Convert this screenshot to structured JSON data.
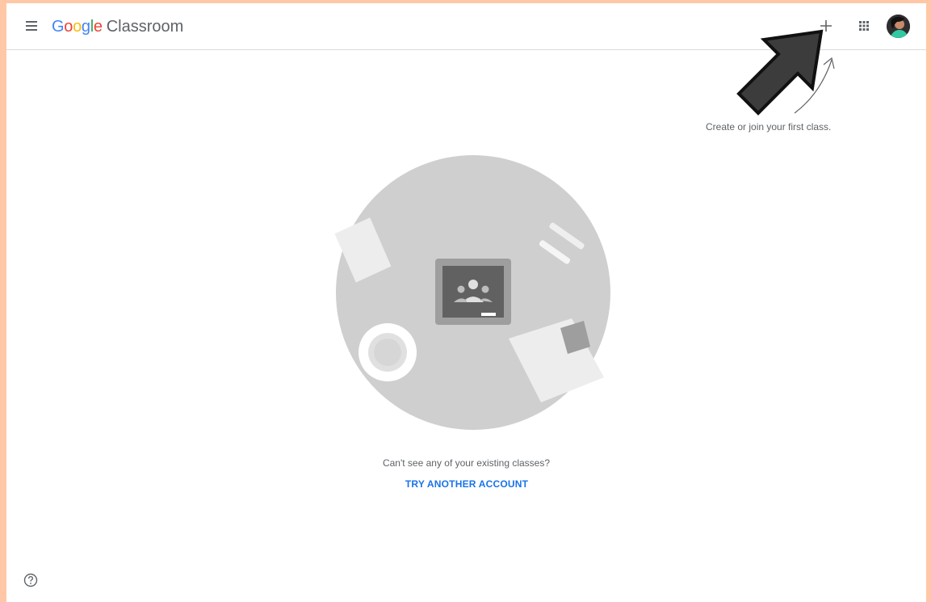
{
  "header": {
    "logo_google": "Google",
    "logo_product": "Classroom",
    "menu_icon": "hamburger-menu-icon",
    "create_icon": "plus-icon",
    "apps_icon": "apps-grid-icon",
    "avatar_icon": "account-avatar"
  },
  "hint": {
    "text": "Create or join your first class."
  },
  "empty_state": {
    "question": "Can't see any of your existing classes?",
    "action": "TRY ANOTHER ACCOUNT"
  },
  "footer": {
    "help_icon": "help-icon"
  },
  "colors": {
    "google_blue": "#4285f4",
    "google_red": "#ea4335",
    "google_yellow": "#fbbc05",
    "google_green": "#34a853",
    "link_blue": "#1a73e8",
    "frame_background": "#ffc7a6"
  }
}
